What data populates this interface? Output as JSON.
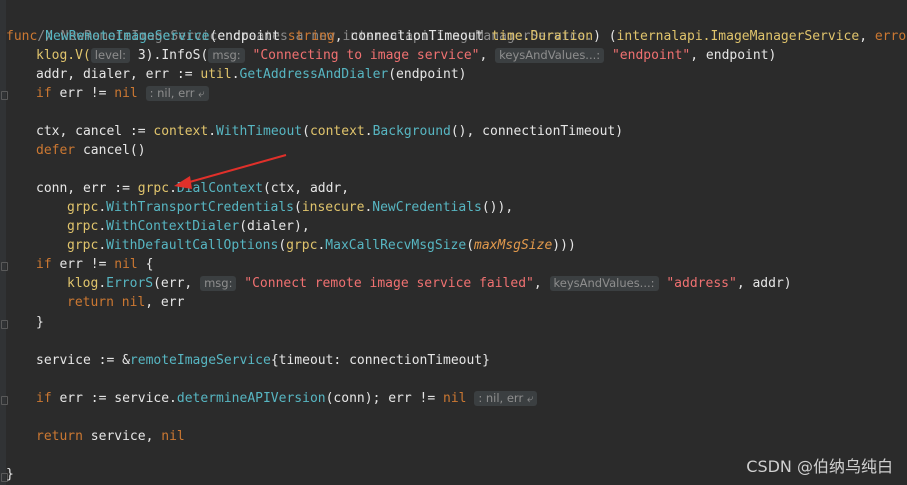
{
  "code": {
    "l1_comment": "// NewRemoteImageService creates a new internalapi.ImageManagerService.",
    "l2": {
      "kw": "func",
      "name": "NewRemoteImageService",
      "p1": "(endpoint ",
      "t1": "string",
      "p2": ", connectionTimeout ",
      "t2": "time.Duration",
      "p3": ") (",
      "t3": "internalapi.ImageManagerService",
      "p4": ", ",
      "t4": "error",
      "p5": ")"
    },
    "l3": {
      "a": "klog.V(",
      "hint_level": "level:",
      "b": "3).InfoS(",
      "hint_msg": "msg:",
      "str": "\"Connecting to image service\"",
      "c": ", ",
      "hint_kv": "keysAndValues...:",
      "str2": "\"endpoint\"",
      "d": ", endpoint)"
    },
    "l4": {
      "a": "addr, dialer, err := ",
      "pkg": "util",
      "b": ".",
      "fn": "GetAddressAndDialer",
      "c": "(endpoint)"
    },
    "l5": {
      "kw": "if",
      "a": " err != ",
      "nil": "nil",
      "hint": ": nil, err ⤶"
    },
    "l7": {
      "a": "ctx, cancel := ",
      "pkg": "context",
      "b": ".",
      "fn": "WithTimeout",
      "c": "(",
      "pkg2": "context",
      "d": ".",
      "fn2": "Background",
      "e": "(), connectionTimeout)"
    },
    "l8": {
      "kw": "defer",
      "a": " cancel()"
    },
    "l10": {
      "a": "conn, err := ",
      "pkg": "grpc",
      "b": ".",
      "fn": "DialContext",
      "c": "(ctx, addr,"
    },
    "l11": {
      "pkg": "grpc",
      "b": ".",
      "fn": "WithTransportCredentials",
      "c": "(",
      "pkg2": "insecure",
      "d": ".",
      "fn2": "NewCredentials",
      "e": "()),"
    },
    "l12": {
      "pkg": "grpc",
      "b": ".",
      "fn": "WithContextDialer",
      "c": "(dialer),"
    },
    "l13": {
      "pkg": "grpc",
      "b": ".",
      "fn": "WithDefaultCallOptions",
      "c": "(",
      "pkg2": "grpc",
      "d": ".",
      "fn2": "MaxCallRecvMsgSize",
      "e": "(",
      "it": "maxMsgSize",
      "f": ")))"
    },
    "l14": {
      "kw": "if",
      "a": " err != ",
      "nil": "nil",
      "b": " {"
    },
    "l15": {
      "pkg": "klog",
      "b": ".",
      "fn": "ErrorS",
      "c": "(err, ",
      "hint_msg": "msg:",
      "str": "\"Connect remote image service failed\"",
      "d": ", ",
      "hint_kv": "keysAndValues...:",
      "str2": "\"address\"",
      "e": ", addr)"
    },
    "l16": {
      "kw": "return",
      "a": " ",
      "nil": "nil",
      "b": ", err"
    },
    "l17": "}",
    "l19": {
      "a": "service := &",
      "fn": "remoteImageService",
      "b": "{timeout: connectionTimeout}"
    },
    "l21": {
      "kw": "if",
      "a": " err := service.",
      "fn": "determineAPIVersion",
      "b": "(conn); err != ",
      "nil": "nil",
      "hint": ": nil, err ⤶"
    },
    "l23": {
      "kw": "return",
      "a": " service, ",
      "nil": "nil"
    },
    "l25": "}"
  },
  "watermark": "CSDN @伯纳乌纯白",
  "colors": {
    "background": "#2b2b2b",
    "keyword": "#cc7832",
    "function": "#57b6c2",
    "string": "#f07171",
    "arrow": "#e0302a"
  }
}
